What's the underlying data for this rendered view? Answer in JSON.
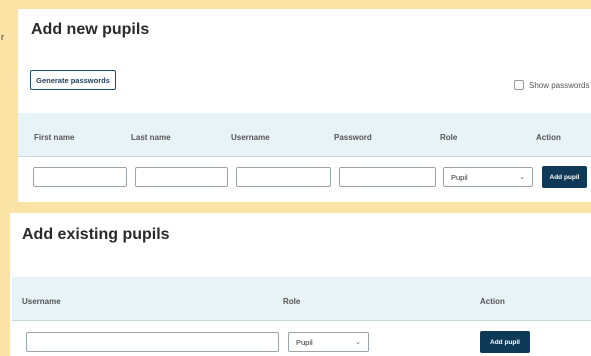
{
  "new_pupils": {
    "title": "Add new pupils",
    "generate_passwords_label": "Generate passwords",
    "show_passwords_label": "Show passwords",
    "columns": [
      "First name",
      "Last name",
      "Username",
      "Password",
      "Role",
      "Action"
    ],
    "role_value": "Pupil",
    "add_button_label": "Add pupil"
  },
  "existing_pupils": {
    "title": "Add existing pupils",
    "columns": [
      "Username",
      "Role",
      "Action"
    ],
    "role_value": "Pupil",
    "add_button_label": "Add pupil"
  },
  "colors": {
    "page_background": "#fbe3a6",
    "header_background": "#e8f3f8",
    "primary_button": "#0f3a57"
  }
}
